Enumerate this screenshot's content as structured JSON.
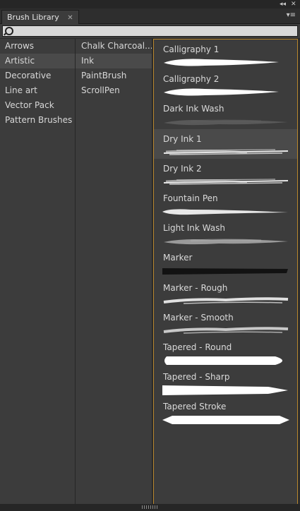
{
  "window": {
    "collapse_icon": "double-chevron-left-icon",
    "close_icon": "close-icon",
    "collapse_glyph": "◂◂",
    "close_glyph": "✕"
  },
  "tab": {
    "title": "Brush Library",
    "close_glyph": "✕",
    "menu_glyph": "▾≡"
  },
  "search": {
    "value": "",
    "placeholder": ""
  },
  "categories": [
    {
      "label": "Arrows"
    },
    {
      "label": "Artistic",
      "selected": true
    },
    {
      "label": "Decorative"
    },
    {
      "label": "Line art"
    },
    {
      "label": "Vector Pack"
    },
    {
      "label": "Pattern Brushes"
    }
  ],
  "subcategories": [
    {
      "label": "Chalk Charcoal..."
    },
    {
      "label": "Ink",
      "selected": true
    },
    {
      "label": "PaintBrush"
    },
    {
      "label": "ScrollPen"
    }
  ],
  "brushes": [
    {
      "label": "Calligraphy 1",
      "style": "calligraphy",
      "color": "#ffffff"
    },
    {
      "label": "Calligraphy 2",
      "style": "calligraphy",
      "color": "#ffffff"
    },
    {
      "label": "Dark Ink Wash",
      "style": "wash",
      "color": "#5e5e5e"
    },
    {
      "label": "Dry Ink 1",
      "style": "dry",
      "color": "#e6e6e6",
      "selected": true
    },
    {
      "label": "Dry Ink 2",
      "style": "dry",
      "color": "#e6e6e6"
    },
    {
      "label": "Fountain Pen",
      "style": "pen",
      "color": "#e8e8e8"
    },
    {
      "label": "Light Ink Wash",
      "style": "wash",
      "color": "#aaaaaa"
    },
    {
      "label": "Marker",
      "style": "marker",
      "color": "#121212"
    },
    {
      "label": "Marker - Rough",
      "style": "rough",
      "color": "#e0e0e0"
    },
    {
      "label": "Marker - Smooth",
      "style": "rough",
      "color": "#c8c8c8"
    },
    {
      "label": "Tapered - Round",
      "style": "round",
      "color": "#ffffff"
    },
    {
      "label": "Tapered - Sharp",
      "style": "sharp",
      "color": "#ffffff"
    },
    {
      "label": "Tapered Stroke",
      "style": "taper",
      "color": "#ffffff"
    }
  ],
  "colors": {
    "accent_border": "#b8862d",
    "panel": "#3c3c3c",
    "selection": "#4a4a4a"
  }
}
